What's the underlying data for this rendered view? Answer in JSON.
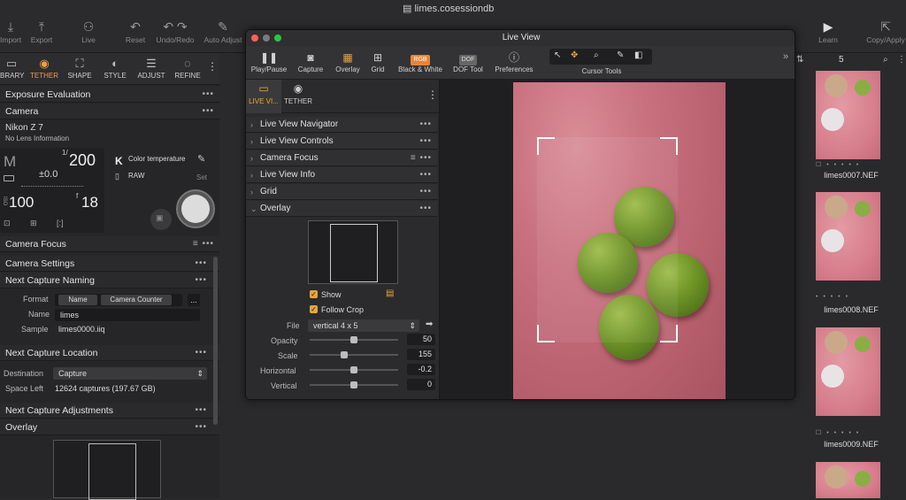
{
  "app": {
    "document_title": "limes.cosessiondb"
  },
  "toolbar": {
    "items": [
      {
        "label": "Import",
        "icon": "import-icon"
      },
      {
        "label": "Export",
        "icon": "export-icon"
      },
      {
        "label": "Live",
        "icon": "live-icon"
      },
      {
        "label": "Reset",
        "icon": "reset-icon"
      },
      {
        "label": "Undo/Redo",
        "icon": "undo-redo-icon"
      },
      {
        "label": "Auto Adjust",
        "icon": "auto-adjust-icon"
      },
      {
        "label": "Learn",
        "icon": "learn-icon"
      },
      {
        "label": "Copy/Apply",
        "icon": "copy-apply-icon"
      }
    ]
  },
  "left_tabs": [
    {
      "label": "BRARY",
      "icon": "library-icon"
    },
    {
      "label": "TETHER",
      "icon": "tether-icon",
      "active": true
    },
    {
      "label": "SHAPE",
      "icon": "shape-icon"
    },
    {
      "label": "STYLE",
      "icon": "style-icon"
    },
    {
      "label": "ADJUST",
      "icon": "adjust-icon"
    },
    {
      "label": "REFINE",
      "icon": "refine-icon"
    }
  ],
  "left": {
    "exposure_title": "Exposure Evaluation",
    "camera_title": "Camera",
    "camera_model": "Nikon Z 7",
    "lens_info": "No Lens Information",
    "mode": "M",
    "shutter": "200",
    "shutter_prefix": "1/",
    "ev": "±0.0",
    "iso_label": "ISO",
    "iso": "100",
    "aperture": "18",
    "aperture_prefix": "f",
    "wb_key": "K",
    "wb_label": "Color temperature",
    "format": "RAW",
    "set_label": "Set",
    "camera_focus": "Camera Focus",
    "camera_settings": "Camera Settings",
    "next_naming": "Next Capture Naming",
    "format_label": "Format",
    "format_name": "Name",
    "format_counter": "Camera Counter",
    "more": "...",
    "name_label": "Name",
    "name_value": "limes",
    "sample_label": "Sample",
    "sample_value": "limes0000.iiq",
    "next_location": "Next Capture Location",
    "destination_label": "Destination",
    "destination_value": "Capture",
    "space_label": "Space Left",
    "space_value": "12624 captures (197.67 GB)",
    "next_adjustments": "Next Capture Adjustments",
    "overlay": "Overlay"
  },
  "liveview": {
    "title": "Live View",
    "toolbar": [
      {
        "label": "Play/Pause",
        "icon": "pause-icon"
      },
      {
        "label": "Capture",
        "icon": "camera-icon"
      },
      {
        "label": "Overlay",
        "icon": "overlay-icon"
      },
      {
        "label": "Grid",
        "icon": "grid-icon"
      },
      {
        "label": "Black & White",
        "icon": "rgb-icon",
        "badge": "RGB"
      },
      {
        "label": "DOF Tool",
        "icon": "dof-icon",
        "badge": "DOF"
      },
      {
        "label": "Preferences",
        "icon": "preferences-icon"
      },
      {
        "label": "Cursor Tools",
        "icon": "cursor-tools-icon"
      }
    ],
    "tabs": [
      {
        "label": "LIVE VI...",
        "active": true
      },
      {
        "label": "TETHER"
      }
    ],
    "sections": [
      "Live View Navigator",
      "Live View Controls",
      "Camera Focus",
      "Live View Info",
      "Grid",
      "Overlay"
    ],
    "overlay": {
      "show_label": "Show",
      "show_checked": true,
      "follow_crop_label": "Follow Crop",
      "follow_crop_checked": true,
      "file_label": "File",
      "file_value": "vertical 4 x 5",
      "opacity_label": "Opacity",
      "opacity": "50",
      "opacity_pct": 0.5,
      "scale_label": "Scale",
      "scale": "155",
      "scale_pct": 0.38,
      "horizontal_label": "Horizontal",
      "horizontal": "-0.2",
      "horizontal_pct": 0.5,
      "vertical_label": "Vertical",
      "vertical": "0",
      "vertical_pct": 0.5
    }
  },
  "right": {
    "count": "5",
    "thumbs": [
      {
        "caption": "limes0007.NEF"
      },
      {
        "caption": "limes0008.NEF"
      },
      {
        "caption": "limes0009.NEF"
      },
      {
        "caption": ""
      }
    ]
  },
  "colors": {
    "accent": "#f0a040",
    "background": "#2a2a2c",
    "photo": "#c8707e"
  }
}
